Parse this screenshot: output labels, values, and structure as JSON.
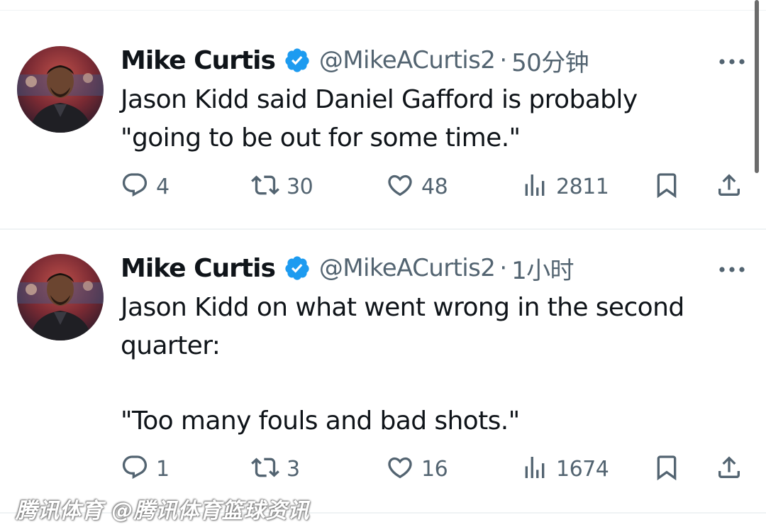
{
  "tweets": [
    {
      "author_name": "Mike Curtis",
      "handle": "@MikeACurtis2",
      "separator": "·",
      "time": "50分钟",
      "text_lines": [
        "Jason Kidd said Daniel Gafford is probably",
        "\"going to be out for some time.\""
      ],
      "stats": {
        "replies": "4",
        "retweets": "30",
        "likes": "48",
        "views": "2811"
      }
    },
    {
      "author_name": "Mike Curtis",
      "handle": "@MikeACurtis2",
      "separator": "·",
      "time": "1小时",
      "text_lines": [
        "Jason Kidd on what went wrong in the second",
        "quarter:",
        "\"Too many fouls and bad shots.\""
      ],
      "stats": {
        "replies": "1",
        "retweets": "3",
        "likes": "16",
        "views": "1674"
      }
    }
  ],
  "watermark": "腾讯体育 @腾讯体育篮球资讯",
  "colors": {
    "verified": "#1d9bf0",
    "secondary_text": "#536471",
    "primary_text": "#0f1419"
  },
  "icons": [
    "reply-icon",
    "retweet-icon",
    "like-icon",
    "views-icon",
    "bookmark-icon",
    "share-icon",
    "more-icon",
    "verified-badge-icon"
  ]
}
